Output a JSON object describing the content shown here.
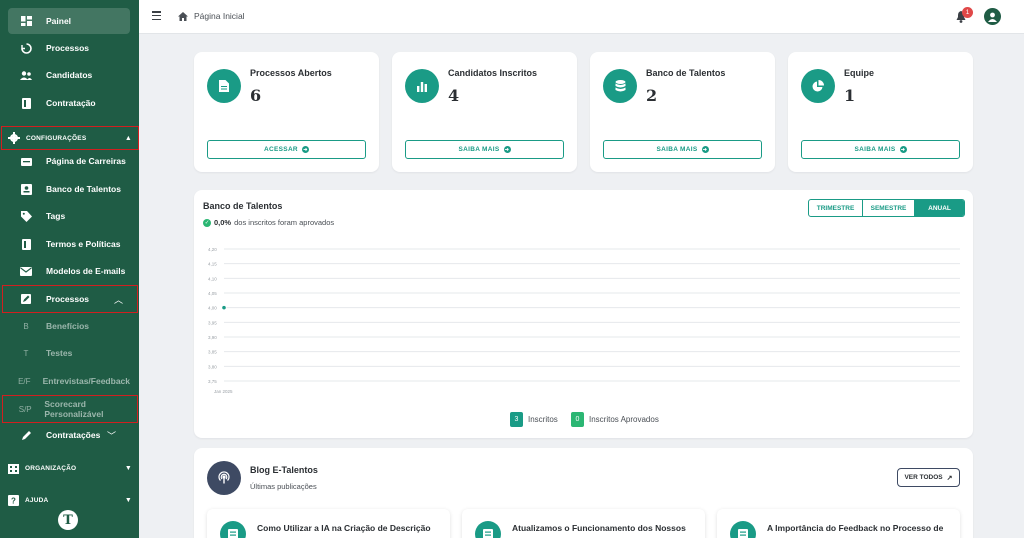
{
  "sidebar": {
    "items": [
      {
        "label": "Painel",
        "icon": "dashboard-icon"
      },
      {
        "label": "Processos",
        "icon": "processes-icon"
      },
      {
        "label": "Candidatos",
        "icon": "people-icon"
      },
      {
        "label": "Contratação",
        "icon": "contract-icon"
      }
    ],
    "config_section": "CONFIGURAÇÕES",
    "config_items": [
      {
        "label": "Página de Carreiras",
        "icon": "careers-icon"
      },
      {
        "label": "Banco de Talentos",
        "icon": "talent-bank-icon"
      },
      {
        "label": "Tags",
        "icon": "tag-icon"
      },
      {
        "label": "Termos e Políticas",
        "icon": "document-icon"
      },
      {
        "label": "Modelos de E-mails",
        "icon": "mail-icon"
      },
      {
        "label": "Processos",
        "icon": "edit-icon"
      }
    ],
    "process_subitems": [
      {
        "abbr": "B",
        "label": "Benefícios"
      },
      {
        "abbr": "T",
        "label": "Testes"
      },
      {
        "abbr": "E/F",
        "label": "Entrevistas/Feedback"
      },
      {
        "abbr": "S/P",
        "label": "Scorecard Personalizável"
      }
    ],
    "contratacoes": "Contratações",
    "org_section": "ORGANIZAÇÃO",
    "help_section": "AJUDA",
    "logo_letter": "T"
  },
  "topbar": {
    "breadcrumb": "Página Inicial",
    "notification_count": "1"
  },
  "stats": [
    {
      "title": "Processos Abertos",
      "value": "6",
      "button": "ACESSAR",
      "icon": "file-icon"
    },
    {
      "title": "Candidatos Inscritos",
      "value": "4",
      "button": "SAIBA MAIS",
      "icon": "bar-chart-icon"
    },
    {
      "title": "Banco de Talentos",
      "value": "2",
      "button": "SAIBA MAIS",
      "icon": "database-icon"
    },
    {
      "title": "Equipe",
      "value": "1",
      "button": "SAIBA MAIS",
      "icon": "pie-chart-icon"
    }
  ],
  "chart_card": {
    "title": "Banco de Talentos",
    "approved_pct": "0,0%",
    "approved_text": "dos inscritos foram aprovados",
    "periods": [
      "TRIMESTRE",
      "SEMESTRE",
      "ANUAL"
    ],
    "active_period": "ANUAL",
    "legend": [
      {
        "count": "3",
        "label": "Inscritos",
        "color": "#1a9b86"
      },
      {
        "count": "0",
        "label": "Inscritos Aprovados",
        "color": "#2bb673"
      }
    ]
  },
  "chart_data": {
    "type": "line",
    "x": [
      "Jan 2025"
    ],
    "series": [
      {
        "values": [
          4.0
        ]
      }
    ],
    "yticks": [
      "4,20",
      "4,15",
      "4,10",
      "4,05",
      "4,00",
      "3,95",
      "3,90",
      "3,85",
      "3,80",
      "3,75"
    ],
    "ylim": [
      3.75,
      4.2
    ],
    "grid": true
  },
  "blog": {
    "title": "Blog E-Talentos",
    "subtitle": "Últimas publicações",
    "view_all": "VER TODOS",
    "posts": [
      {
        "title": "Como Utilizar a IA na Criação de Descrição"
      },
      {
        "title": "Atualizamos o Funcionamento dos Nossos"
      },
      {
        "title": "A Importância do Feedback no Processo de"
      }
    ]
  },
  "colors": {
    "sidebar": "#1f5c45",
    "accent": "#1a9b86",
    "success": "#2bb673",
    "highlight": "#d21f1f"
  }
}
